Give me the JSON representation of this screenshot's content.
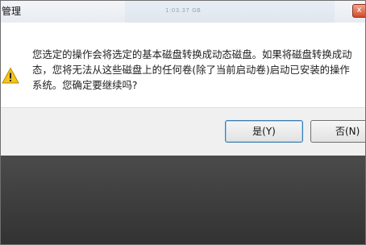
{
  "window": {
    "title": "管理",
    "background_text": "1:03.37 GB",
    "close_glyph": "x"
  },
  "dialog": {
    "message": "您选定的操作会将选定的基本磁盘转换成动态磁盘。如果将磁盘转换成动\n态，您将无法从这些磁盘上的任何卷(除了当前启动卷)启动已安装的操作\n系统。您确定要继续吗?",
    "icon": "warning-icon",
    "yes_label": "是(Y)",
    "no_label": "否(N)"
  },
  "colors": {
    "warning_fill": "#f5c518",
    "close_button": "#cf4e2d",
    "focus_border": "#3c7fb1"
  }
}
